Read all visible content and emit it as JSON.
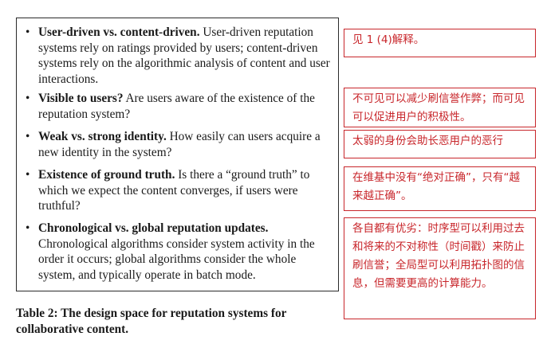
{
  "bullets": [
    {
      "term": "User-driven vs. content-driven.",
      "text": " User-driven reputation systems rely on ratings provided by users; content-driven systems rely on the algorithmic analysis of content and user interactions."
    },
    {
      "term": "Visible to users?",
      "text": " Are users aware of the existence of the reputation system?"
    },
    {
      "term": "Weak vs. strong identity.",
      "text": " How easily can users acquire a new identity in the system?"
    },
    {
      "term": "Existence of ground truth.",
      "text": " Is there a “ground truth” to which we expect the content converges, if users were truthful?"
    },
    {
      "term": "Chronological vs. global reputation updates.",
      "text": " Chronological algorithms consider system activity in the order it occurs; global algorithms consider the whole system, and typically operate in batch mode."
    }
  ],
  "caption": "Table 2: The design space for reputation systems for collaborative content.",
  "notes": [
    "见 1 (4)解释。",
    "不可见可以减少刷信誉作弊；而可见可以促进用户的积极性。",
    "太弱的身份会助长恶用户的恶行",
    "在维基中没有“绝对正确”，只有“越来越正确”。",
    "各自都有优劣：时序型可以利用过去和将来的不对称性（时间戳）来防止刷信誉；全局型可以利用拓扑图的信息，但需要更高的计算能力。"
  ]
}
